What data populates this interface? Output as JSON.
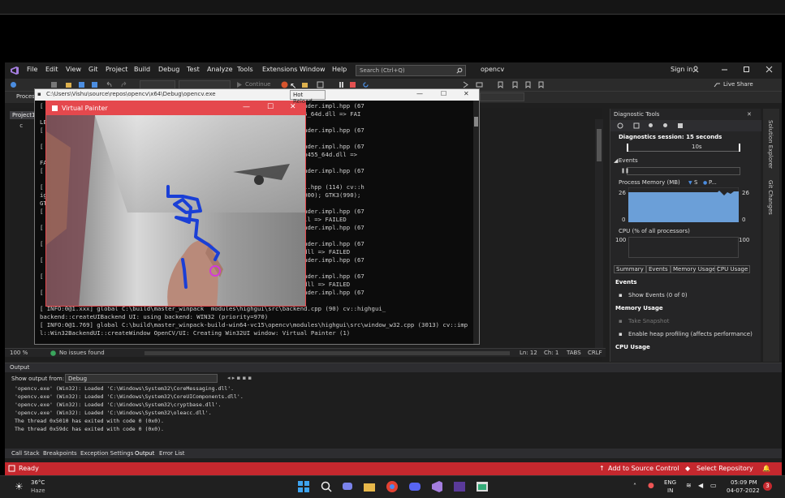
{
  "vs": {
    "menu": [
      "File",
      "Edit",
      "View",
      "Git",
      "Project",
      "Build",
      "Debug",
      "Test",
      "Analyze",
      "Tools",
      "Extensions",
      "Window",
      "Help"
    ],
    "search_placeholder": "Search (Ctrl+Q)",
    "solution_name": "opencv",
    "sign_in": "Sign in",
    "live_share": "Live Share",
    "continue_label": "Continue",
    "process_label": "Proces",
    "editor_tab": "Project1",
    "editor_line": "c",
    "zoom": "100 %",
    "issues": "No issues found",
    "position": {
      "ln": "Ln: 12",
      "ch": "Ch: 1",
      "tabs": "TABS",
      "crlf": "CRLF"
    }
  },
  "diagnostics": {
    "title": "Diagnostic Tools",
    "session": "Diagnostics session: 15 seconds",
    "timeline_tick": "10s",
    "events_label": "Events",
    "process_memory": "Process Memory (MB)",
    "legend_s": "S",
    "legend_p": "P...",
    "mem_max_left": "26",
    "mem_min_left": "0",
    "mem_max_right": "26",
    "mem_min_right": "0",
    "cpu_label": "CPU (% of all processors)",
    "cpu_max_left": "100",
    "cpu_max_right": "100",
    "tabs": [
      "Summary",
      "Events",
      "Memory Usage",
      "CPU Usage"
    ],
    "section_events": "Events",
    "show_events": "Show Events (0 of 0)",
    "section_memory": "Memory Usage",
    "take_snapshot": "Take Snapshot",
    "heap_profiling": "Enable heap profiling (affects performance)",
    "section_cpu": "CPU Usage",
    "side_tabs": [
      "Solution Explorer",
      "Git Changes"
    ]
  },
  "output": {
    "title": "Output",
    "show_from": "Show output from:",
    "source": "Debug",
    "lines": [
      "'opencv.exe' (Win32): Loaded 'C:\\Windows\\System32\\CoreMessaging.dll'.",
      "'opencv.exe' (Win32): Loaded 'C:\\Windows\\System32\\CoreUIComponents.dll'.",
      "'opencv.exe' (Win32): Loaded 'C:\\Windows\\System32\\cryptbase.dll'.",
      "'opencv.exe' (Win32): Loaded 'C:\\Windows\\System32\\oleacc.dll'.",
      "The thread 0x5010 has exited with code 0 (0x0).",
      "The thread 0x59dc has exited with code 0 (0x0)."
    ],
    "bottom_tabs": [
      "Call Stack",
      "Breakpoints",
      "Exception Settings",
      "Output",
      "Error List"
    ]
  },
  "statusbar": {
    "ready": "Ready",
    "add_source": "Add to Source Control",
    "select_repo": "Select Repository"
  },
  "console": {
    "title": "C:\\Users\\Vishu\\source\\repos\\opencv\\x64\\Debug\\opencv.exe",
    "lines": [
      "[ IN                                         ules\\core\\src\\utils\\plugin_loader.impl.hpp (67",
      "  c                                          in\\opencv_core_parallel_tbb455_64d.dll => FAI",
      "LED",
      "[ IN                                         ules\\core\\src\\utils\\plugin_loader.impl.hpp (67",
      "  c                                          55_64d.dll => FAILED",
      "[ IN                                         ules\\core\\src\\utils\\plugin_loader.impl.hpp (67",
      "  c                                          in\\opencv_core_parallel_openmp455_64d.dll => ",
      "FAI",
      "[ IN                                         ules\\core\\src\\utils\\plugin_loader.impl.hpp (67",
      "  c                                          pp455_64d.dll => FAILED",
      "[ IN                                         ules\\highgui\\src\\registry.impl.hpp (114) cv::h",
      "igh                                          s, sorted by priority): GTK(1000); GTK3(990);",
      "GTK",
      "[ IN                                         ules\\core\\src\\utils\\plugin_loader.impl.hpp (67",
      "  c                                          in\\opencv_highgui_gtk455_64.dll => FAILED",
      "[ IN                                         ules\\core\\src\\utils\\plugin_loader.impl.hpp (67",
      "  c                                          => FAILED",
      "[ IN                                         ules\\core\\src\\utils\\plugin_loader.impl.hpp (67",
      "  c                                          in\\opencv_highgui_gtk3455_64.dll => FAILED",
      "[ IN                                         ules\\core\\src\\utils\\plugin_loader.impl.hpp (67",
      "  c                                          => FAILED",
      "[ IN                                         ules\\core\\src\\utils\\plugin_loader.impl.hpp (67",
      "  c                                          in\\opencv_highgui_gtk2455_64.dll => FAILED",
      "[ IN                                         ules\\core\\src\\utils\\plugin_loader.impl.hpp (67",
      "  c                                          dll => FAILED",
      "[ INFO:0@1.xxx] global C:\\build\\master_winpack  modules\\highgui\\src\\backend.cpp (90) cv::highgui_",
      "backend::createUIBackend UI: using backend: WIN32 (priority=970)",
      "[ INFO:0@1.769] global C:\\build\\master_winpack-build-win64-vc15\\opencv\\modules\\highgui\\src\\window_w32.cpp (3013) cv::imp",
      "l::Win32BackendUI::createWindow OpenCV/UI: Creating Win32UI window: Virtual Painter (1)"
    ]
  },
  "painter": {
    "title": "Virtual Painter"
  },
  "tooltip": "Hot Reload",
  "taskbar": {
    "temp": "36°C",
    "weather": "Haze",
    "lang1": "ENG",
    "lang2": "IN",
    "time": "05:09 PM",
    "date": "04-07-2022",
    "badge": "3"
  },
  "colors": {
    "accent_red": "#c5282e",
    "window_red": "#e5484d",
    "brush": "#1a3fd6",
    "cursor": "#d23ad8"
  }
}
